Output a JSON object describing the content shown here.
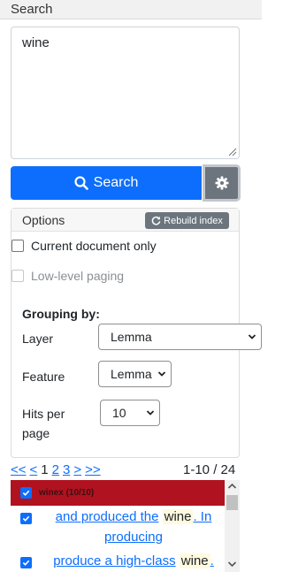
{
  "header": {
    "title": "Search"
  },
  "query": {
    "value": "wine"
  },
  "buttons": {
    "search_label": "Search"
  },
  "options": {
    "title": "Options",
    "rebuild_label": "Rebuild index",
    "current_doc_label": "Current document only",
    "low_level_label": "Low-level paging",
    "grouping_title": "Grouping by:",
    "layer_label": "Layer",
    "layer_value": "Lemma",
    "feature_label": "Feature",
    "feature_value": "Lemma",
    "hits_label_1": "Hits per",
    "hits_label_2": "page",
    "hits_value": "10"
  },
  "pager": {
    "first": "<<",
    "prev": "<",
    "pages": [
      "1",
      "2",
      "3"
    ],
    "next": ">",
    "last": ">>",
    "range": "1-10 / 24"
  },
  "results": {
    "group_label": "winex (10/10)",
    "hits": [
      {
        "left": "and produced the",
        "keyword": "wine",
        "right": ". In",
        "line2": "producing"
      },
      {
        "left": "produce a high-class",
        "keyword": "wine",
        "right": "."
      }
    ]
  },
  "colors": {
    "primary": "#0d6efd",
    "secondary": "#6c757d",
    "group": "#b0121f"
  }
}
